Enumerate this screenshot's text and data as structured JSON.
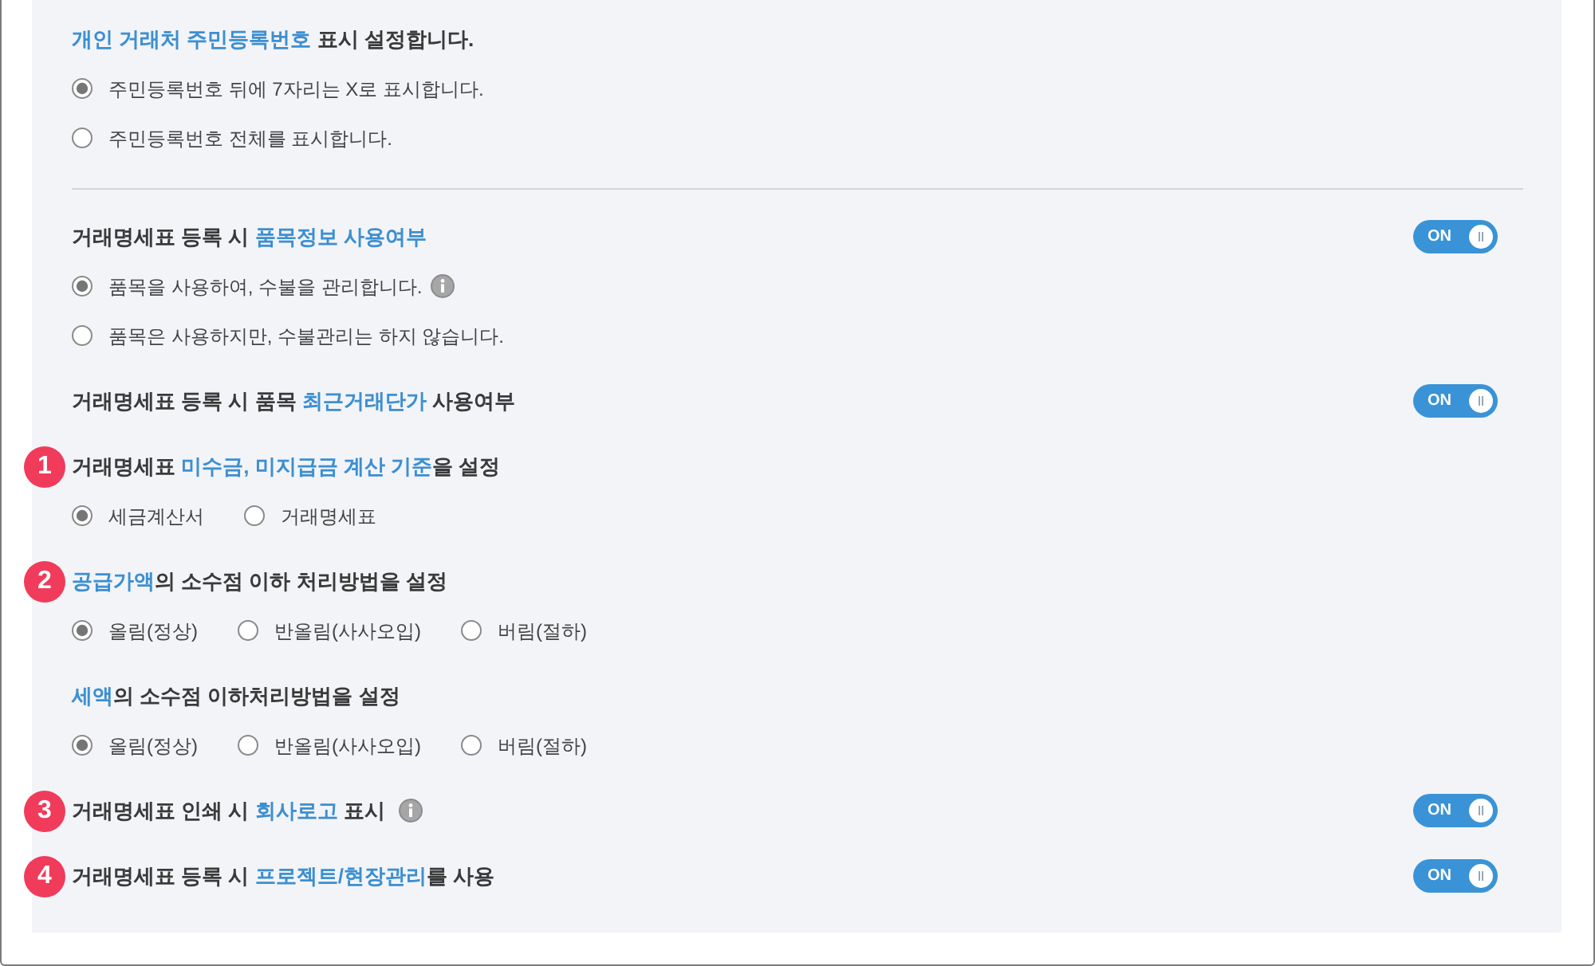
{
  "sections": [
    {
      "kind": "stacked",
      "divider": true,
      "info": false,
      "title": [
        {
          "text": "개인 거래처 주민등록번호",
          "highlight": true
        },
        {
          "text": " 표시 설정합니다.",
          "highlight": false
        }
      ],
      "options": [
        {
          "label": "주민등록번호 뒤에 7자리는 X로 표시합니다.",
          "selected": true,
          "info": false
        },
        {
          "label": "주민등록번호 전체를 표시합니다.",
          "selected": false,
          "info": false
        }
      ]
    },
    {
      "kind": "stacked",
      "divider": false,
      "info": false,
      "title": [
        {
          "text": "거래명세표 등록 시 ",
          "highlight": false
        },
        {
          "text": "품목정보 사용여부",
          "highlight": true
        }
      ],
      "toggle": {
        "label": "ON",
        "on": true
      },
      "options": [
        {
          "label": "품목을 사용하여, 수불을 관리합니다.",
          "selected": true,
          "info": true
        },
        {
          "label": "품목은 사용하지만, 수불관리는 하지 않습니다.",
          "selected": false,
          "info": false
        }
      ]
    },
    {
      "kind": "plain",
      "divider": false,
      "info": false,
      "title": [
        {
          "text": "거래명세표 등록 시 품목 ",
          "highlight": false
        },
        {
          "text": "최근거래단가",
          "highlight": true
        },
        {
          "text": " 사용여부",
          "highlight": false
        }
      ],
      "toggle": {
        "label": "ON",
        "on": true
      }
    },
    {
      "kind": "inline",
      "divider": false,
      "info": false,
      "step": "1",
      "title": [
        {
          "text": "거래명세표 ",
          "highlight": false
        },
        {
          "text": "미수금, 미지급금 계산 기준",
          "highlight": true
        },
        {
          "text": "을 설정",
          "highlight": false
        }
      ],
      "options": [
        {
          "label": "세금계산서",
          "selected": true,
          "info": false
        },
        {
          "label": "거래명세표",
          "selected": false,
          "info": false
        }
      ]
    },
    {
      "kind": "inline",
      "divider": false,
      "info": false,
      "step": "2",
      "title": [
        {
          "text": "공급가액",
          "highlight": true
        },
        {
          "text": "의 소수점 이하 처리방법을 설정",
          "highlight": false
        }
      ],
      "options": [
        {
          "label": "올림(정상)",
          "selected": true,
          "info": false
        },
        {
          "label": "반올림(사사오입)",
          "selected": false,
          "info": false
        },
        {
          "label": "버림(절하)",
          "selected": false,
          "info": false
        }
      ]
    },
    {
      "kind": "inline",
      "divider": false,
      "info": false,
      "title": [
        {
          "text": "세액",
          "highlight": true
        },
        {
          "text": "의 소수점 이하처리방법을 설정",
          "highlight": false
        }
      ],
      "options": [
        {
          "label": "올림(정상)",
          "selected": true,
          "info": false
        },
        {
          "label": "반올림(사사오입)",
          "selected": false,
          "info": false
        },
        {
          "label": "버림(절하)",
          "selected": false,
          "info": false
        }
      ]
    },
    {
      "kind": "plain",
      "divider": false,
      "info": true,
      "step": "3",
      "title": [
        {
          "text": "거래명세표 인쇄 시 ",
          "highlight": false
        },
        {
          "text": "회사로고",
          "highlight": true
        },
        {
          "text": " 표시",
          "highlight": false
        }
      ],
      "toggle": {
        "label": "ON",
        "on": true
      }
    },
    {
      "kind": "plain",
      "divider": false,
      "info": false,
      "step": "4",
      "title": [
        {
          "text": "거래명세표 등록 시 ",
          "highlight": false
        },
        {
          "text": "프로젝트/현장관리",
          "highlight": true
        },
        {
          "text": "를 사용",
          "highlight": false
        }
      ],
      "toggle": {
        "label": "ON",
        "on": true
      }
    }
  ]
}
